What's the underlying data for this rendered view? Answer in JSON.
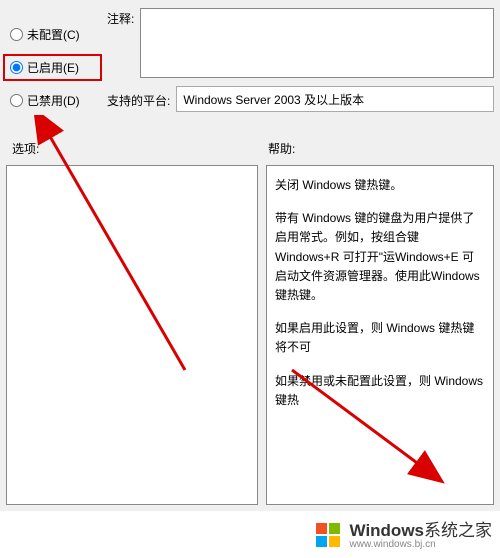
{
  "radios": {
    "not_configured": "未配置(C)",
    "enabled": "已启用(E)",
    "disabled": "已禁用(D)"
  },
  "labels": {
    "comment": "注释:",
    "platform": "支持的平台:",
    "options": "选项:",
    "help": "帮助:"
  },
  "platform_value": "Windows Server 2003 及以上版本",
  "help_text": {
    "p1": "关闭 Windows 键热键。",
    "p2": "带有 Windows 键的键盘为用户提供了启用常式。例如，按组合键 Windows+R 可打开\"运Windows+E 可启动文件资源管理器。使用此Windows 键热键。",
    "p3": "如果启用此设置，则 Windows 键热键将不可",
    "p4": "如果禁用或未配置此设置，则 Windows 键热"
  },
  "watermark": {
    "brand": "Windows",
    "suffix": "系统之家",
    "url": "www.windows.bj.cn"
  }
}
